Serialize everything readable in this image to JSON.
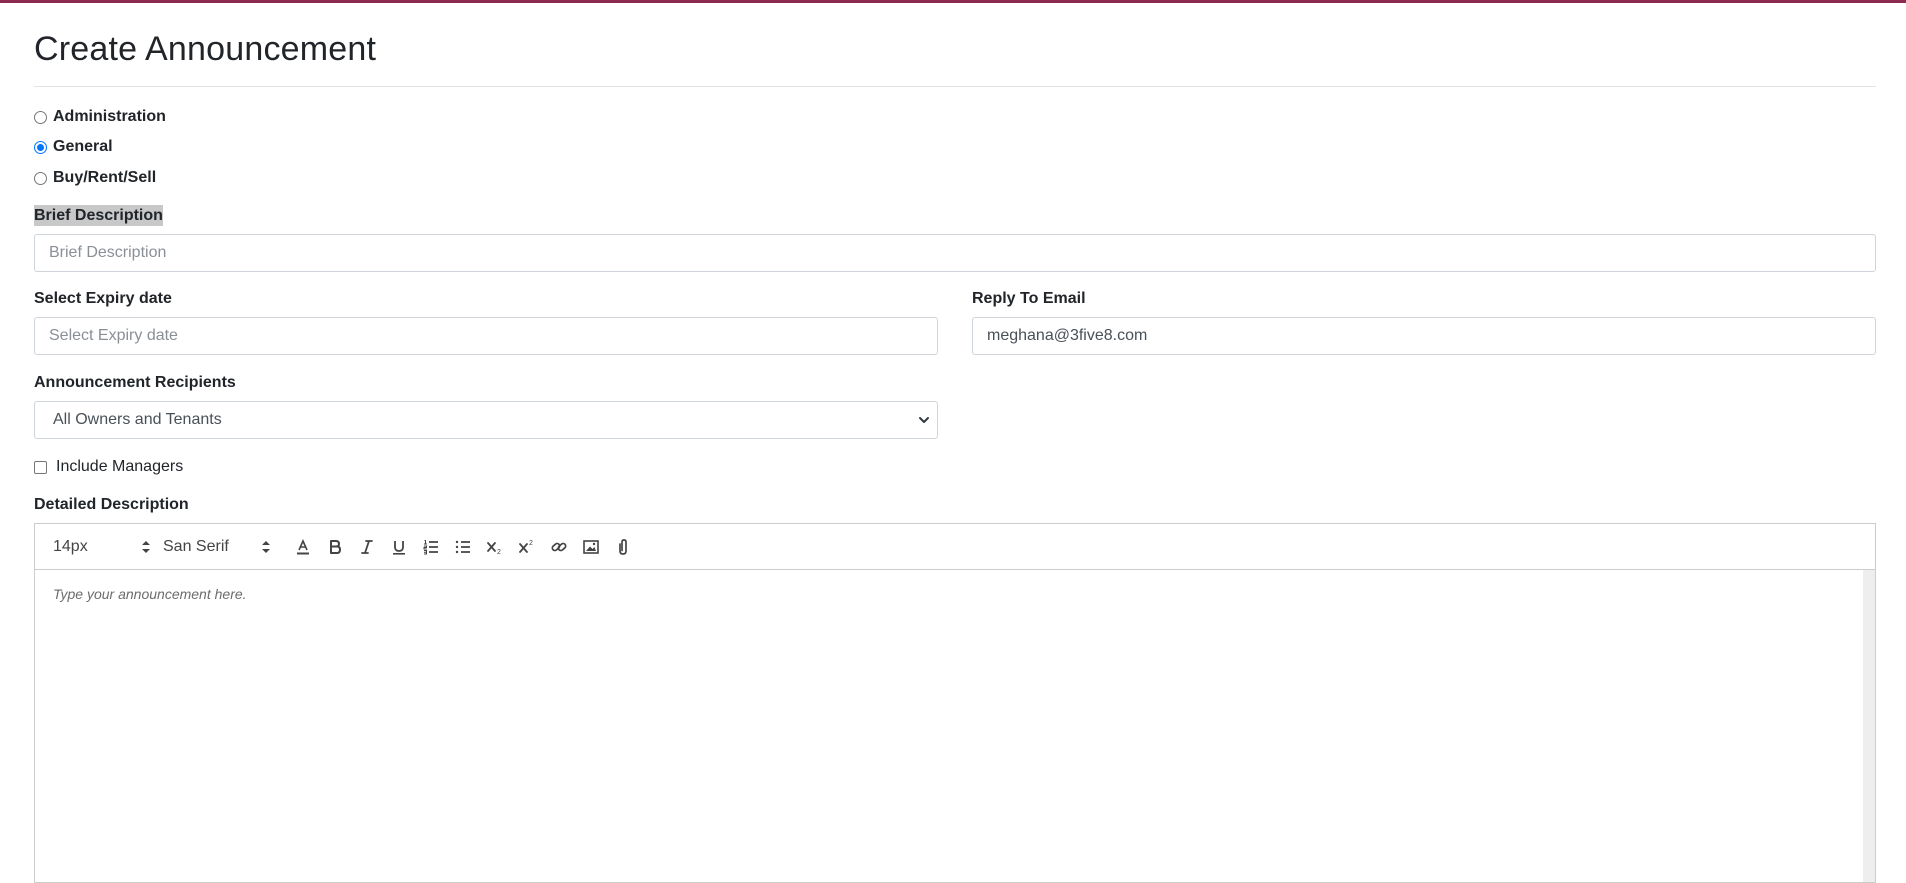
{
  "page": {
    "title": "Create Announcement",
    "accent_color": "#8e2a4f"
  },
  "category": {
    "options": [
      {
        "label": "Administration",
        "checked": false
      },
      {
        "label": "General",
        "checked": true
      },
      {
        "label": "Buy/Rent/Sell",
        "checked": false
      }
    ]
  },
  "brief": {
    "label": "Brief Description",
    "placeholder": "Brief Description",
    "value": ""
  },
  "expiry": {
    "label": "Select Expiry date",
    "placeholder": "Select Expiry date",
    "value": ""
  },
  "reply": {
    "label": "Reply To Email",
    "value": "meghana@3five8.com"
  },
  "recipients": {
    "label": "Announcement Recipients",
    "selected": "All Owners and Tenants"
  },
  "include_managers": {
    "label": "Include Managers",
    "checked": false
  },
  "detailed": {
    "label": "Detailed Description",
    "placeholder": "Type your announcement here.",
    "toolbar": {
      "font_size": "14px",
      "font_family": "San Serif",
      "icons": [
        "text-color-icon",
        "bold-icon",
        "italic-icon",
        "underline-icon",
        "ordered-list-icon",
        "bullet-list-icon",
        "subscript-icon",
        "superscript-icon",
        "link-icon",
        "image-icon",
        "attachment-icon"
      ]
    }
  }
}
